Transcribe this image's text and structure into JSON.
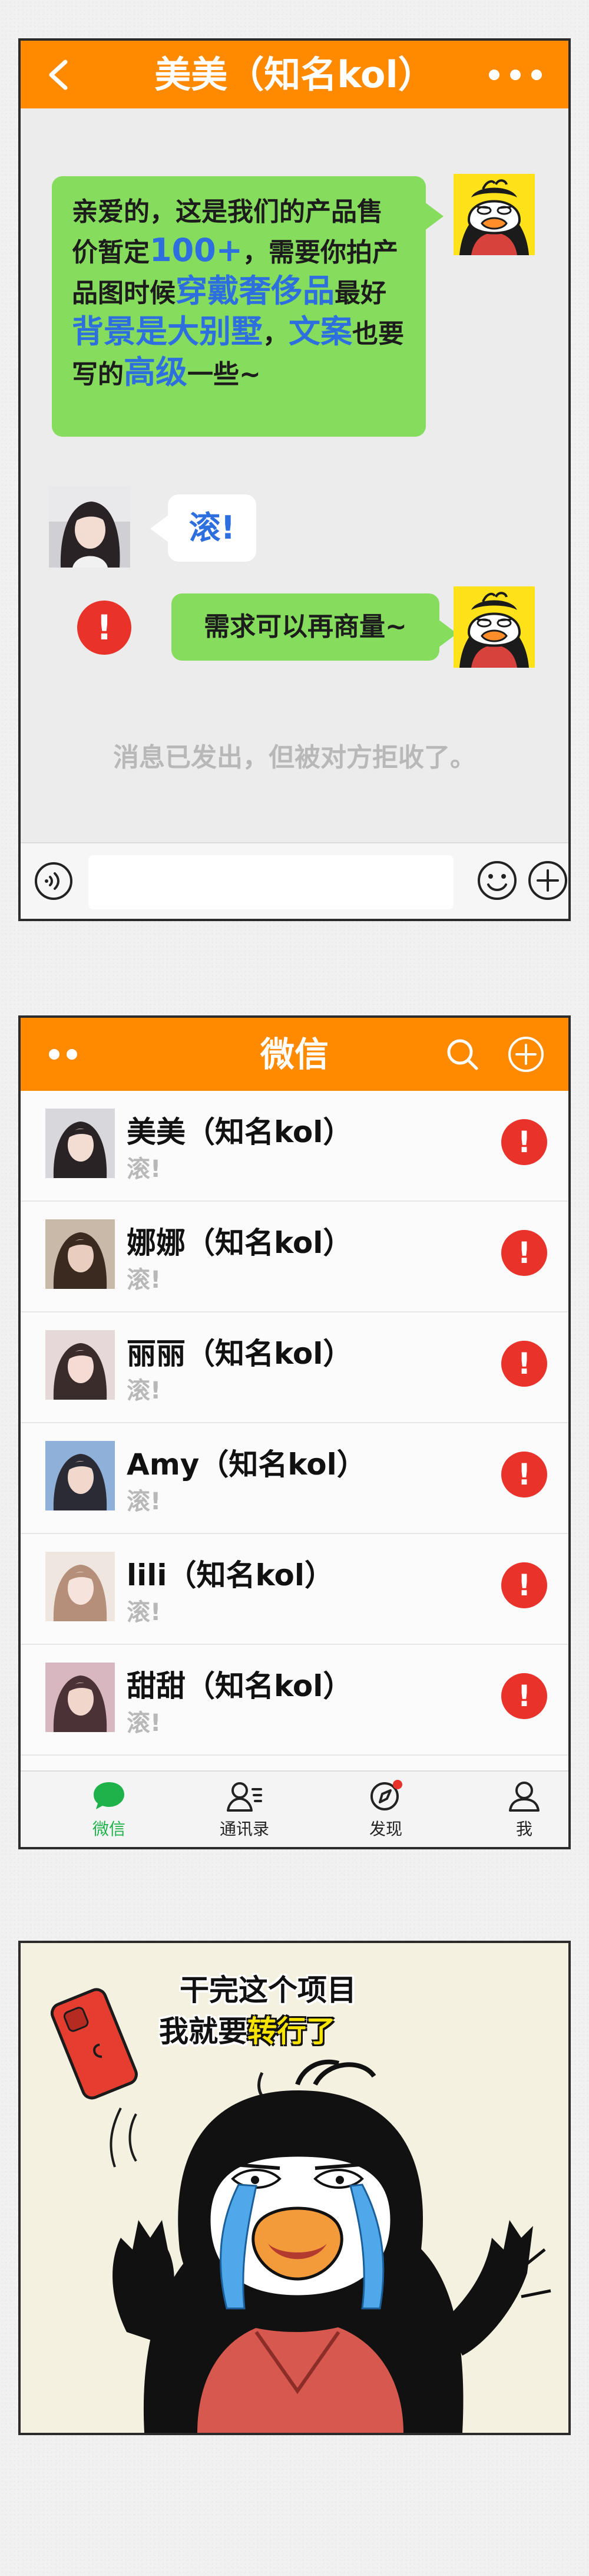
{
  "chat": {
    "title": "美美（知名kol）",
    "messages": {
      "first": [
        {
          "t": "亲爱的，这是我们的产品售价暂定",
          "hl": false
        },
        {
          "t": "100+",
          "hl": true
        },
        {
          "t": "，需要你拍产品图时候",
          "hl": false
        },
        {
          "t": "穿戴奢侈品",
          "hl": true
        },
        {
          "t": "最好",
          "hl": false
        },
        {
          "t": "背景是大别墅",
          "hl": true
        },
        {
          "t": "，",
          "hl": false
        },
        {
          "t": "文案",
          "hl": true
        },
        {
          "t": "也要写的",
          "hl": false
        },
        {
          "t": "高级",
          "hl": true
        },
        {
          "t": "一些~",
          "hl": false
        }
      ],
      "reply": "滚!",
      "second": "需求可以再商量~",
      "error_mark": "!"
    },
    "system_notice": "消息已发出，但被对方拒收了。",
    "input_value": ""
  },
  "wechat": {
    "title": "微信",
    "contacts": [
      {
        "name": "美美（知名kol）",
        "last_message": "滚!"
      },
      {
        "name": "娜娜（知名kol）",
        "last_message": "滚!"
      },
      {
        "name": "丽丽（知名kol）",
        "last_message": "滚!"
      },
      {
        "name": "Amy（知名kol）",
        "last_message": "滚!"
      },
      {
        "name": "lili（知名kol）",
        "last_message": "滚!"
      },
      {
        "name": "甜甜（知名kol）",
        "last_message": "滚!"
      }
    ],
    "error_mark": "!",
    "tabs": [
      {
        "label": "微信",
        "icon": "chat-bubble-icon",
        "active": true
      },
      {
        "label": "通讯录",
        "icon": "contacts-icon",
        "active": false
      },
      {
        "label": "发现",
        "icon": "compass-icon",
        "active": false,
        "badge": true
      },
      {
        "label": "我",
        "icon": "person-icon",
        "active": false
      }
    ]
  },
  "comic": {
    "caption_line1": "干完这个项目",
    "caption_line2_prefix": "我就要",
    "caption_line2_highlight": "转行了"
  },
  "colors": {
    "header": "#ff8a00",
    "bubble_green": "#86dc5c",
    "highlight_blue": "#2e6fe0",
    "error_red": "#e8322a",
    "active_tab_green": "#1fb24a"
  }
}
